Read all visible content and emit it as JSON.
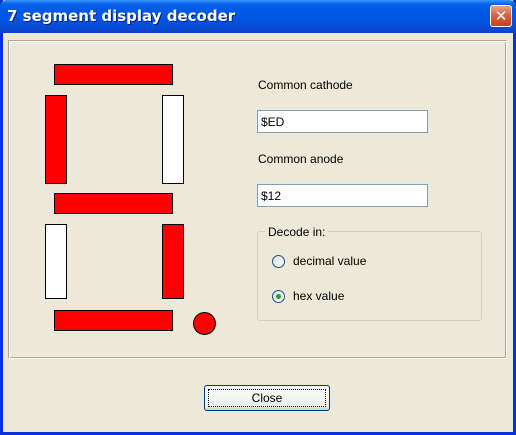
{
  "window": {
    "title": "7 segment display decoder",
    "close_glyph": "✕",
    "close_icon": "close-icon"
  },
  "segments": {
    "a": true,
    "b": false,
    "c": true,
    "d": true,
    "e": false,
    "f": true,
    "g": true,
    "dp": true,
    "on_color": "#FF0000",
    "off_color": "#FFFFFF"
  },
  "fields": {
    "cathode_label": "Common cathode",
    "cathode_value": "$ED",
    "anode_label": "Common anode",
    "anode_value": "$12"
  },
  "decode": {
    "group_label": "Decode in:",
    "options": [
      {
        "label": "decimal value",
        "selected": false
      },
      {
        "label": "hex value",
        "selected": true
      }
    ]
  },
  "buttons": {
    "close_label": "Close"
  }
}
